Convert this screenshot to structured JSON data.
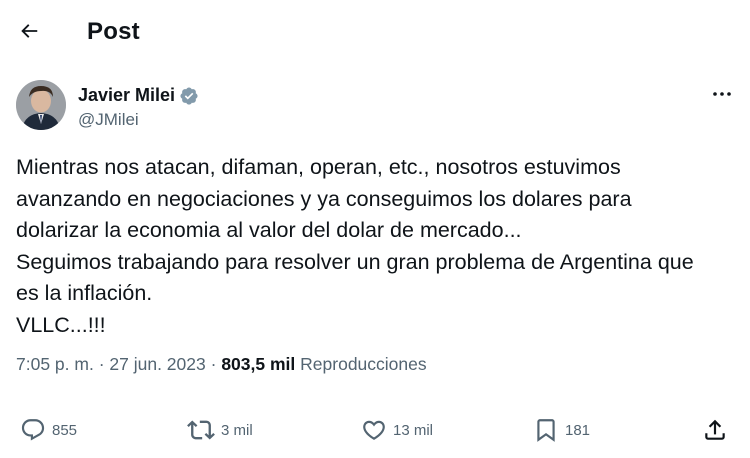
{
  "header": {
    "back_icon": "arrow-left-icon",
    "title": "Post"
  },
  "author": {
    "display_name": "Javier Milei",
    "handle": "@JMilei",
    "verified_icon": "verified-badge-icon",
    "more_icon": "more-horizontal-icon"
  },
  "tweet": {
    "lines": [
      "Mientras nos atacan, difaman, operan, etc., nosotros estuvimos",
      "avanzando en negociaciones y ya conseguimos los dolares para",
      "dolarizar la economia al valor del dolar de mercado...",
      "Seguimos trabajando para resolver un gran problema de Argentina que",
      "es la inflación.",
      "VLLC...!!!"
    ]
  },
  "meta": {
    "time": "7:05 p. m.",
    "separator": "·",
    "date": "27 jun. 2023",
    "views_count": "803,5 mil",
    "views_label": "Reproducciones"
  },
  "actions": {
    "replies": "855",
    "reposts": "3 mil",
    "likes": "13 mil",
    "bookmarks": "181"
  },
  "colors": {
    "text_primary": "#0f1419",
    "text_secondary": "#536471",
    "verified_badge": "#829aab"
  }
}
